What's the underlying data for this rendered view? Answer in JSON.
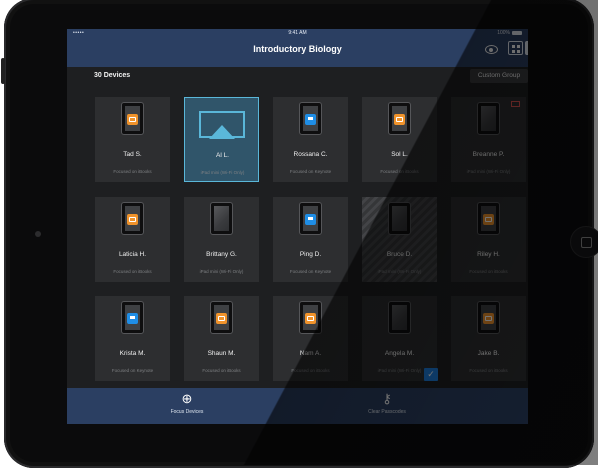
{
  "status": {
    "carrier": "•••••",
    "time": "9:41 AM",
    "battery": "100%"
  },
  "nav": {
    "title": "Introductory Biology"
  },
  "header": {
    "count": "30 Devices",
    "group_button": "Custom Group"
  },
  "devices": [
    {
      "name": "Tad S.",
      "status": "Focused on iBooks",
      "app": "ibooks"
    },
    {
      "name": "Al L.",
      "status": "iPad mini (Wi-Fi Only)",
      "app": "airplay"
    },
    {
      "name": "Rossana C.",
      "status": "Focused on Keynote",
      "app": "keynote"
    },
    {
      "name": "Sol L.",
      "status": "Focused on iBooks",
      "app": "ibooks"
    },
    {
      "name": "Breanne P.",
      "status": "iPad mini (Wi-Fi Only)",
      "app": "none"
    },
    {
      "name": "Laticia H.",
      "status": "Focused on iBooks",
      "app": "ibooks"
    },
    {
      "name": "Brittany G.",
      "status": "iPad mini (Wi-Fi Only)",
      "app": "none"
    },
    {
      "name": "Ping D.",
      "status": "Focused on Keynote",
      "app": "keynote"
    },
    {
      "name": "Bruce D.",
      "status": "iPad mini (Wi-Fi Only)",
      "app": "none"
    },
    {
      "name": "Riley H.",
      "status": "Focused on iBooks",
      "app": "ibooks"
    },
    {
      "name": "Krista M.",
      "status": "Focused on Keynote",
      "app": "keynote"
    },
    {
      "name": "Shaun M.",
      "status": "Focused on iBooks",
      "app": "ibooks"
    },
    {
      "name": "Nam A.",
      "status": "Focused on iBooks",
      "app": "ibooks"
    },
    {
      "name": "Angela M.",
      "status": "iPad mini (Wi-Fi Only)",
      "app": "none"
    },
    {
      "name": "Jake B.",
      "status": "Focused on iBooks",
      "app": "ibooks"
    }
  ],
  "toolbar": {
    "focus_label": "Focus Devices",
    "clear_label": "Clear Passcodes",
    "focus_icon": "crosshair-icon",
    "clear_icon": "key-icon"
  },
  "colors": {
    "nav": "#2b3f62",
    "accent": "#5ab7d9",
    "ibooks": "#f0932b",
    "keynote": "#1f8ee6",
    "check": "#1d7fe0"
  }
}
